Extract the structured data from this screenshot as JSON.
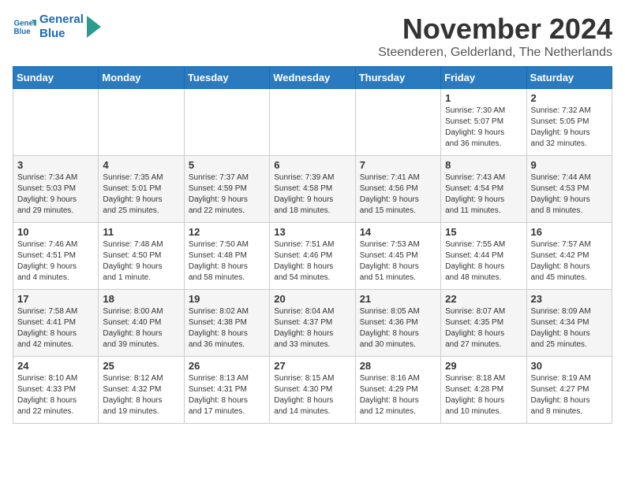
{
  "logo": {
    "line1": "General",
    "line2": "Blue"
  },
  "title": "November 2024",
  "location": "Steenderen, Gelderland, The Netherlands",
  "days": [
    "Sunday",
    "Monday",
    "Tuesday",
    "Wednesday",
    "Thursday",
    "Friday",
    "Saturday"
  ],
  "weeks": [
    [
      {
        "day": "",
        "info": ""
      },
      {
        "day": "",
        "info": ""
      },
      {
        "day": "",
        "info": ""
      },
      {
        "day": "",
        "info": ""
      },
      {
        "day": "",
        "info": ""
      },
      {
        "day": "1",
        "info": "Sunrise: 7:30 AM\nSunset: 5:07 PM\nDaylight: 9 hours\nand 36 minutes."
      },
      {
        "day": "2",
        "info": "Sunrise: 7:32 AM\nSunset: 5:05 PM\nDaylight: 9 hours\nand 32 minutes."
      }
    ],
    [
      {
        "day": "3",
        "info": "Sunrise: 7:34 AM\nSunset: 5:03 PM\nDaylight: 9 hours\nand 29 minutes."
      },
      {
        "day": "4",
        "info": "Sunrise: 7:35 AM\nSunset: 5:01 PM\nDaylight: 9 hours\nand 25 minutes."
      },
      {
        "day": "5",
        "info": "Sunrise: 7:37 AM\nSunset: 4:59 PM\nDaylight: 9 hours\nand 22 minutes."
      },
      {
        "day": "6",
        "info": "Sunrise: 7:39 AM\nSunset: 4:58 PM\nDaylight: 9 hours\nand 18 minutes."
      },
      {
        "day": "7",
        "info": "Sunrise: 7:41 AM\nSunset: 4:56 PM\nDaylight: 9 hours\nand 15 minutes."
      },
      {
        "day": "8",
        "info": "Sunrise: 7:43 AM\nSunset: 4:54 PM\nDaylight: 9 hours\nand 11 minutes."
      },
      {
        "day": "9",
        "info": "Sunrise: 7:44 AM\nSunset: 4:53 PM\nDaylight: 9 hours\nand 8 minutes."
      }
    ],
    [
      {
        "day": "10",
        "info": "Sunrise: 7:46 AM\nSunset: 4:51 PM\nDaylight: 9 hours\nand 4 minutes."
      },
      {
        "day": "11",
        "info": "Sunrise: 7:48 AM\nSunset: 4:50 PM\nDaylight: 9 hours\nand 1 minute."
      },
      {
        "day": "12",
        "info": "Sunrise: 7:50 AM\nSunset: 4:48 PM\nDaylight: 8 hours\nand 58 minutes."
      },
      {
        "day": "13",
        "info": "Sunrise: 7:51 AM\nSunset: 4:46 PM\nDaylight: 8 hours\nand 54 minutes."
      },
      {
        "day": "14",
        "info": "Sunrise: 7:53 AM\nSunset: 4:45 PM\nDaylight: 8 hours\nand 51 minutes."
      },
      {
        "day": "15",
        "info": "Sunrise: 7:55 AM\nSunset: 4:44 PM\nDaylight: 8 hours\nand 48 minutes."
      },
      {
        "day": "16",
        "info": "Sunrise: 7:57 AM\nSunset: 4:42 PM\nDaylight: 8 hours\nand 45 minutes."
      }
    ],
    [
      {
        "day": "17",
        "info": "Sunrise: 7:58 AM\nSunset: 4:41 PM\nDaylight: 8 hours\nand 42 minutes."
      },
      {
        "day": "18",
        "info": "Sunrise: 8:00 AM\nSunset: 4:40 PM\nDaylight: 8 hours\nand 39 minutes."
      },
      {
        "day": "19",
        "info": "Sunrise: 8:02 AM\nSunset: 4:38 PM\nDaylight: 8 hours\nand 36 minutes."
      },
      {
        "day": "20",
        "info": "Sunrise: 8:04 AM\nSunset: 4:37 PM\nDaylight: 8 hours\nand 33 minutes."
      },
      {
        "day": "21",
        "info": "Sunrise: 8:05 AM\nSunset: 4:36 PM\nDaylight: 8 hours\nand 30 minutes."
      },
      {
        "day": "22",
        "info": "Sunrise: 8:07 AM\nSunset: 4:35 PM\nDaylight: 8 hours\nand 27 minutes."
      },
      {
        "day": "23",
        "info": "Sunrise: 8:09 AM\nSunset: 4:34 PM\nDaylight: 8 hours\nand 25 minutes."
      }
    ],
    [
      {
        "day": "24",
        "info": "Sunrise: 8:10 AM\nSunset: 4:33 PM\nDaylight: 8 hours\nand 22 minutes."
      },
      {
        "day": "25",
        "info": "Sunrise: 8:12 AM\nSunset: 4:32 PM\nDaylight: 8 hours\nand 19 minutes."
      },
      {
        "day": "26",
        "info": "Sunrise: 8:13 AM\nSunset: 4:31 PM\nDaylight: 8 hours\nand 17 minutes."
      },
      {
        "day": "27",
        "info": "Sunrise: 8:15 AM\nSunset: 4:30 PM\nDaylight: 8 hours\nand 14 minutes."
      },
      {
        "day": "28",
        "info": "Sunrise: 8:16 AM\nSunset: 4:29 PM\nDaylight: 8 hours\nand 12 minutes."
      },
      {
        "day": "29",
        "info": "Sunrise: 8:18 AM\nSunset: 4:28 PM\nDaylight: 8 hours\nand 10 minutes."
      },
      {
        "day": "30",
        "info": "Sunrise: 8:19 AM\nSunset: 4:27 PM\nDaylight: 8 hours\nand 8 minutes."
      }
    ]
  ]
}
